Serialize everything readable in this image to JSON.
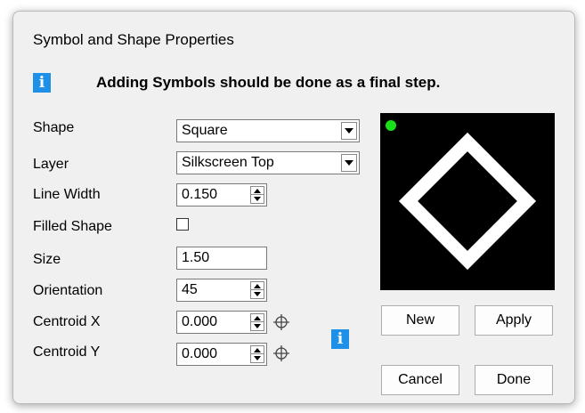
{
  "window": {
    "title": "Symbol and Shape Properties",
    "info_message": "Adding Symbols should be done as a final step."
  },
  "form": {
    "shape": {
      "label": "Shape",
      "value": "Square"
    },
    "layer": {
      "label": "Layer",
      "value": "Silkscreen Top"
    },
    "line_width": {
      "label": "Line Width",
      "value": "0.150"
    },
    "filled_shape": {
      "label": "Filled Shape",
      "checked": false
    },
    "size": {
      "label": "Size",
      "value": "1.50"
    },
    "orientation": {
      "label": "Orientation",
      "value": "45"
    },
    "centroid_x": {
      "label": "Centroid X",
      "value": "0.000"
    },
    "centroid_y": {
      "label": "Centroid Y",
      "value": "0.000"
    }
  },
  "preview": {
    "shape": "square",
    "rotation_deg": 45,
    "background_color": "#000000",
    "shape_color": "#ffffff",
    "marker_color": "#18e018"
  },
  "buttons": {
    "new": "New",
    "apply": "Apply",
    "cancel": "Cancel",
    "done": "Done"
  },
  "icons": {
    "info": "info-icon",
    "target": "crosshair-icon"
  },
  "colors": {
    "info_blue": "#1e90e8",
    "dialog_bg": "#f0f0f0"
  }
}
